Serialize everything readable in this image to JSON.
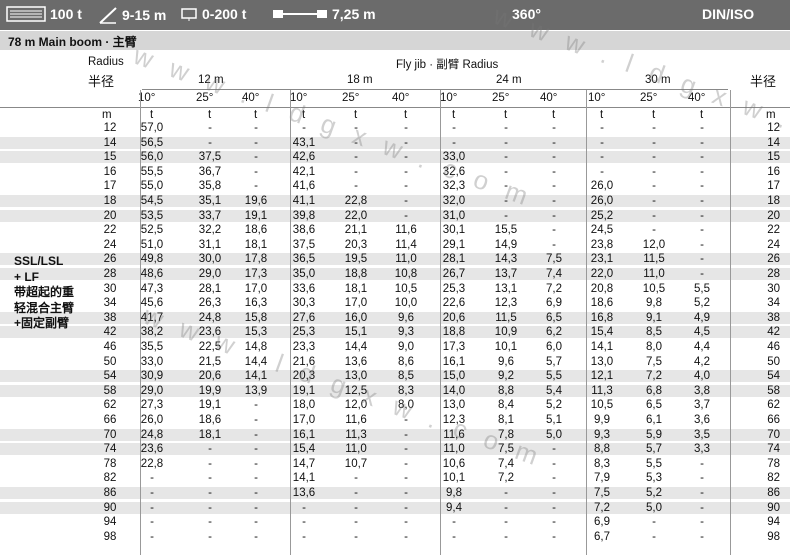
{
  "topbar": {
    "counterweight": "100 t",
    "superlift": "9-15 m",
    "sl_weight": "0-200 t",
    "track": "7,25 m",
    "slew": "360°",
    "standard": "DIN/ISO"
  },
  "subbar": {
    "config": "78 m   Main boom · 主臂"
  },
  "headers": {
    "radius_en": "Radius",
    "radius_cn": "半径",
    "radius_cn_right": "半径",
    "fly_jib": "Fly jib ·  副臂 Radius",
    "jib_lengths": [
      "12 m",
      "18 m",
      "24 m",
      "30 m"
    ],
    "angles": [
      "10°",
      "25°",
      "40°",
      "10°",
      "25°",
      "40°",
      "10°",
      "25°",
      "40°",
      "10°",
      "25°",
      "40°"
    ],
    "unit_m": "m",
    "unit_t": "t"
  },
  "side_label": [
    "SSL/LSL",
    "+ LF",
    "带超起的重",
    "轻混合主臂",
    "+固定副臂"
  ],
  "rows": [
    {
      "r": "12",
      "v": [
        "57,0",
        "-",
        "-",
        "-",
        "-",
        "-",
        "-",
        "-",
        "-",
        "-",
        "-",
        "-"
      ]
    },
    {
      "r": "14",
      "v": [
        "56,5",
        "-",
        "-",
        "43,1",
        "-",
        "-",
        "-",
        "-",
        "-",
        "-",
        "-",
        "-"
      ]
    },
    {
      "r": "15",
      "v": [
        "56,0",
        "37,5",
        "-",
        "42,6",
        "-",
        "-",
        "33,0",
        "-",
        "-",
        "-",
        "-",
        "-"
      ]
    },
    {
      "r": "16",
      "v": [
        "55,5",
        "36,7",
        "-",
        "42,1",
        "-",
        "-",
        "32,6",
        "-",
        "-",
        "-",
        "-",
        "-"
      ]
    },
    {
      "r": "17",
      "v": [
        "55,0",
        "35,8",
        "-",
        "41,6",
        "-",
        "-",
        "32,3",
        "-",
        "-",
        "26,0",
        "-",
        "-"
      ]
    },
    {
      "r": "18",
      "v": [
        "54,5",
        "35,1",
        "19,6",
        "41,1",
        "22,8",
        "-",
        "32,0",
        "-",
        "-",
        "26,0",
        "-",
        "-"
      ]
    },
    {
      "r": "20",
      "v": [
        "53,5",
        "33,7",
        "19,1",
        "39,8",
        "22,0",
        "-",
        "31,0",
        "-",
        "-",
        "25,2",
        "-",
        "-"
      ]
    },
    {
      "r": "22",
      "v": [
        "52,5",
        "32,2",
        "18,6",
        "38,6",
        "21,1",
        "11,6",
        "30,1",
        "15,5",
        "-",
        "24,5",
        "-",
        "-"
      ]
    },
    {
      "r": "24",
      "v": [
        "51,0",
        "31,1",
        "18,1",
        "37,5",
        "20,3",
        "11,4",
        "29,1",
        "14,9",
        "-",
        "23,8",
        "12,0",
        "-"
      ]
    },
    {
      "r": "26",
      "v": [
        "49,8",
        "30,0",
        "17,8",
        "36,5",
        "19,5",
        "11,0",
        "28,1",
        "14,3",
        "7,5",
        "23,1",
        "11,5",
        "-"
      ]
    },
    {
      "r": "28",
      "v": [
        "48,6",
        "29,0",
        "17,3",
        "35,0",
        "18,8",
        "10,8",
        "26,7",
        "13,7",
        "7,4",
        "22,0",
        "11,0",
        "-"
      ]
    },
    {
      "r": "30",
      "v": [
        "47,3",
        "28,1",
        "17,0",
        "33,6",
        "18,1",
        "10,5",
        "25,3",
        "13,1",
        "7,2",
        "20,8",
        "10,5",
        "5,5"
      ]
    },
    {
      "r": "34",
      "v": [
        "45,6",
        "26,3",
        "16,3",
        "30,3",
        "17,0",
        "10,0",
        "22,6",
        "12,3",
        "6,9",
        "18,6",
        "9,8",
        "5,2"
      ]
    },
    {
      "r": "38",
      "v": [
        "41,7",
        "24,8",
        "15,8",
        "27,6",
        "16,0",
        "9,6",
        "20,6",
        "11,5",
        "6,5",
        "16,8",
        "9,1",
        "4,9"
      ]
    },
    {
      "r": "42",
      "v": [
        "38,2",
        "23,6",
        "15,3",
        "25,3",
        "15,1",
        "9,3",
        "18,8",
        "10,9",
        "6,2",
        "15,4",
        "8,5",
        "4,5"
      ]
    },
    {
      "r": "46",
      "v": [
        "35,5",
        "22,5",
        "14,8",
        "23,3",
        "14,4",
        "9,0",
        "17,3",
        "10,1",
        "6,0",
        "14,1",
        "8,0",
        "4,4"
      ]
    },
    {
      "r": "50",
      "v": [
        "33,0",
        "21,5",
        "14,4",
        "21,6",
        "13,6",
        "8,6",
        "16,1",
        "9,6",
        "5,7",
        "13,0",
        "7,5",
        "4,2"
      ]
    },
    {
      "r": "54",
      "v": [
        "30,9",
        "20,6",
        "14,1",
        "20,3",
        "13,0",
        "8,5",
        "15,0",
        "9,2",
        "5,5",
        "12,1",
        "7,2",
        "4,0"
      ]
    },
    {
      "r": "58",
      "v": [
        "29,0",
        "19,9",
        "13,9",
        "19,1",
        "12,5",
        "8,3",
        "14,0",
        "8,8",
        "5,4",
        "11,3",
        "6,8",
        "3,8"
      ]
    },
    {
      "r": "62",
      "v": [
        "27,3",
        "19,1",
        "-",
        "18,0",
        "12,0",
        "8,0",
        "13,0",
        "8,4",
        "5,2",
        "10,5",
        "6,5",
        "3,7"
      ]
    },
    {
      "r": "66",
      "v": [
        "26,0",
        "18,6",
        "-",
        "17,0",
        "11,6",
        "-",
        "12,3",
        "8,1",
        "5,1",
        "9,9",
        "6,1",
        "3,6"
      ]
    },
    {
      "r": "70",
      "v": [
        "24,8",
        "18,1",
        "-",
        "16,1",
        "11,3",
        "-",
        "11,6",
        "7,8",
        "5,0",
        "9,3",
        "5,9",
        "3,5"
      ]
    },
    {
      "r": "74",
      "v": [
        "23,6",
        "-",
        "-",
        "15,4",
        "11,0",
        "-",
        "11,0",
        "7,5",
        "-",
        "8,8",
        "5,7",
        "3,3"
      ]
    },
    {
      "r": "78",
      "v": [
        "22,8",
        "-",
        "-",
        "14,7",
        "10,7",
        "-",
        "10,6",
        "7,4",
        "-",
        "8,3",
        "5,5",
        "-"
      ]
    },
    {
      "r": "82",
      "v": [
        "-",
        "-",
        "-",
        "14,1",
        "-",
        "-",
        "10,1",
        "7,2",
        "-",
        "7,9",
        "5,3",
        "-"
      ]
    },
    {
      "r": "86",
      "v": [
        "-",
        "-",
        "-",
        "13,6",
        "-",
        "-",
        "9,8",
        "-",
        "-",
        "7,5",
        "5,2",
        "-"
      ]
    },
    {
      "r": "90",
      "v": [
        "-",
        "-",
        "-",
        "-",
        "-",
        "-",
        "9,4",
        "-",
        "-",
        "7,2",
        "5,0",
        "-"
      ]
    },
    {
      "r": "94",
      "v": [
        "-",
        "-",
        "-",
        "-",
        "-",
        "-",
        "-",
        "-",
        "-",
        "6,9",
        "-",
        "-"
      ]
    },
    {
      "r": "98",
      "v": [
        "-",
        "-",
        "-",
        "-",
        "-",
        "-",
        "-",
        "-",
        "-",
        "6,7",
        "-",
        "-"
      ]
    }
  ],
  "watermark": "w w w . l d g x w . c o m",
  "colors": {
    "topbar": "#6b6b6b",
    "subbar": "#d6d6d6",
    "stripe": "#e4e4e4"
  }
}
